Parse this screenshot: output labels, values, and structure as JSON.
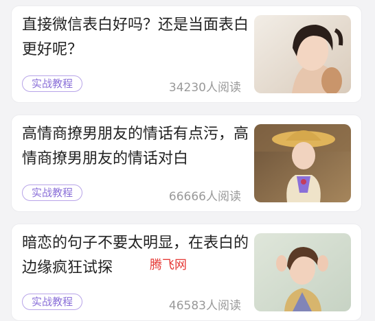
{
  "articles": [
    {
      "title": "直接微信表白好吗？还是当面表白更好呢？",
      "tag": "实战教程",
      "reads": "34230人阅读",
      "thumbnail_icon": "photo-icon"
    },
    {
      "title": "高情商撩男朋友的情话有点污，高情商撩男朋友的情话对白",
      "tag": "实战教程",
      "reads": "66666人阅读",
      "thumbnail_icon": "photo-icon"
    },
    {
      "title": "暗恋的句子不要太明显，在表白的边缘疯狂试探",
      "tag": "实战教程",
      "reads": "46583人阅读",
      "thumbnail_icon": "photo-icon"
    }
  ],
  "watermark": "腾飞网",
  "colors": {
    "background": "#f3f3f5",
    "card": "#ffffff",
    "title_text": "#222222",
    "tag_border": "#b7a3e8",
    "tag_text": "#8a6fd8",
    "meta_text": "#999999",
    "watermark": "#e53935"
  }
}
